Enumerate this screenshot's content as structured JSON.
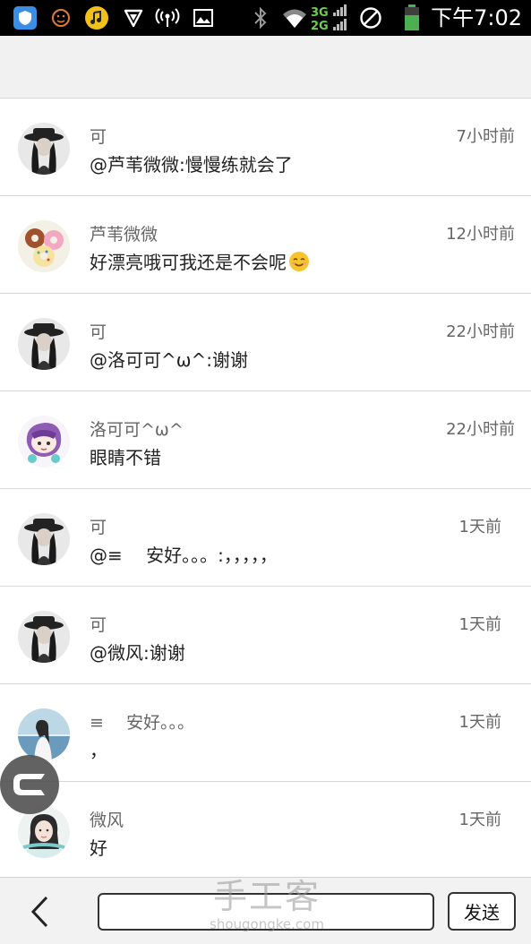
{
  "status_bar": {
    "time": "下午7:02",
    "network_label": "3G 2G",
    "icons": [
      "shield-app-icon",
      "emoji-app-icon",
      "music-app-icon",
      "vpn-icon",
      "hotspot-icon",
      "image-icon",
      "bluetooth-icon",
      "wifi-icon",
      "signal-icon",
      "no-sim-icon",
      "battery-icon"
    ]
  },
  "comments": [
    {
      "name": "可",
      "text": "@芦苇微微:慢慢练就会了",
      "time": "7小时前",
      "avatar": "bw-hat-avatar"
    },
    {
      "name": "芦苇微微",
      "text": "好漂亮哦可我还是不会呢",
      "time": "12小时前",
      "avatar": "donut-avatar",
      "emoji": "smile-emoji"
    },
    {
      "name": "可",
      "text": "@洛可可^ω^:谢谢",
      "time": "22小时前",
      "avatar": "bw-hat-avatar"
    },
    {
      "name": "洛可可^ω^",
      "text": "眼睛不错",
      "time": "22小时前",
      "avatar": "cartoon-purple-avatar"
    },
    {
      "name": "可",
      "text": "@≡　 安好。。。:，，，，，",
      "time": "1天前",
      "avatar": "bw-hat-avatar"
    },
    {
      "name": "可",
      "text": "@微风:谢谢",
      "time": "1天前",
      "avatar": "bw-hat-avatar"
    },
    {
      "name": "≡　 安好。。。",
      "text": "，",
      "time": "1天前",
      "avatar": "sea-girl-avatar"
    },
    {
      "name": "微风",
      "text": "好",
      "time": "1天前",
      "avatar": "girl-portrait-avatar"
    }
  ],
  "bottom_bar": {
    "input_value": "",
    "send_label": "发送"
  },
  "watermark": {
    "main": "手工客",
    "sub": "shougongke.com"
  },
  "colors": {
    "status_bar_bg": "#000000",
    "header_bg": "#f1f1f1",
    "divider": "#d6d6d6",
    "name_text": "#666666",
    "body_text": "#222222"
  }
}
